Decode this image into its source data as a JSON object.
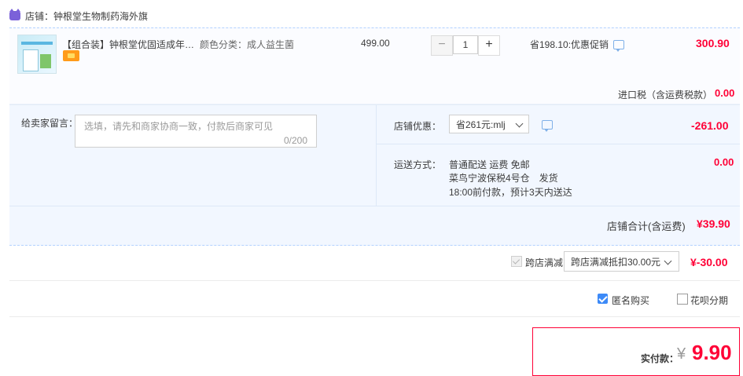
{
  "store": {
    "name": "店铺：钟根堂生物制药海外旗"
  },
  "product": {
    "title": "【组合装】钟根堂优固适成年女...",
    "sku": "颜色分类：成人益生菌",
    "unit_price": "499.00",
    "quantity": "1",
    "promo_text": "省198.10:优惠促销",
    "subtotal": "300.90"
  },
  "tax": {
    "label": "进口税（含运费税款）",
    "value": "0.00"
  },
  "message": {
    "label": "给卖家留言：",
    "placeholder": "选填，请先和商家协商一致，付款后商家可见",
    "count": "0/200"
  },
  "coupon": {
    "label": "店铺优惠：",
    "selected": "省261元:mlj",
    "value": "-261.00"
  },
  "shipping": {
    "label": "运送方式：",
    "method": "普通配送 运费 免邮",
    "warehouse": "菜鸟宁波保税4号仓　发货",
    "eta": "18:00前付款，预计3天内送达",
    "value": "0.00"
  },
  "store_total": {
    "label": "店铺合计(含运费)",
    "value": "¥39.90"
  },
  "cross_store": {
    "label": "跨店满减",
    "selected": "跨店满减抵扣30.00元",
    "value": "¥-30.00",
    "checked": true
  },
  "anonymous": {
    "label": "匿名购买",
    "checked": true
  },
  "huabei": {
    "label": "花呗分期",
    "checked": false
  },
  "payment": {
    "label": "实付款：",
    "currency": "¥",
    "value": "9.90"
  },
  "colors": {
    "accent_red": "#ff0036",
    "link_blue": "#3d8af7",
    "panel_bg": "#f2f7ff"
  }
}
